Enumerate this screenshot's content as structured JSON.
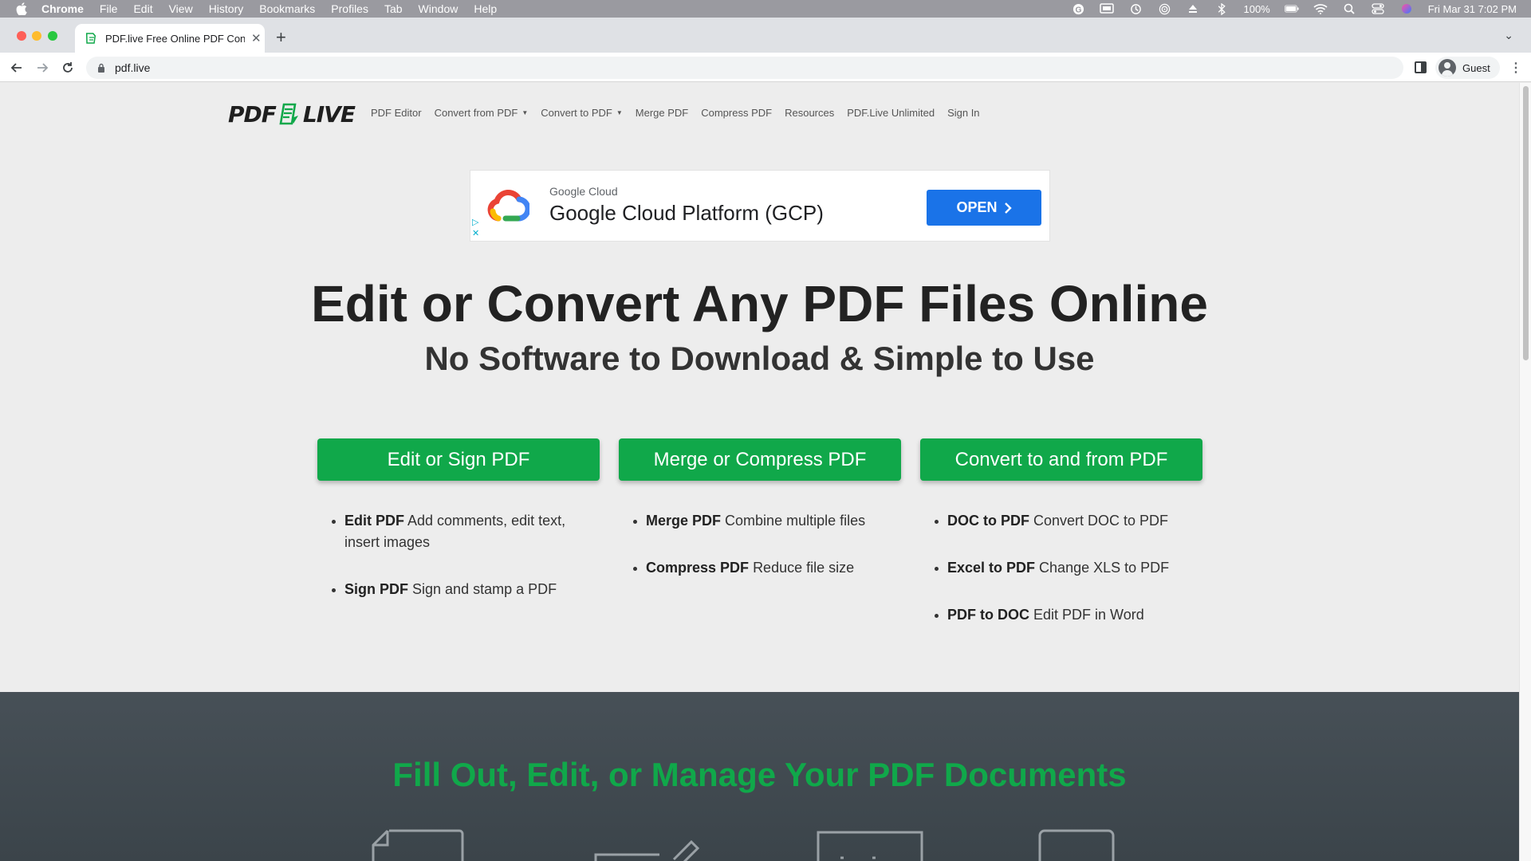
{
  "menubar": {
    "app": "Chrome",
    "items": [
      "File",
      "Edit",
      "View",
      "History",
      "Bookmarks",
      "Profiles",
      "Tab",
      "Window",
      "Help"
    ],
    "battery": "100%",
    "datetime": "Fri Mar 31  7:02 PM"
  },
  "browser": {
    "tab_title": "PDF.live Free Online PDF Conv",
    "url": "pdf.live",
    "profile_label": "Guest"
  },
  "site": {
    "logo_left": "PDF",
    "logo_right": "LIVE",
    "nav": [
      {
        "label": "PDF Editor",
        "dropdown": false
      },
      {
        "label": "Convert from PDF",
        "dropdown": true
      },
      {
        "label": "Convert to PDF",
        "dropdown": true
      },
      {
        "label": "Merge PDF",
        "dropdown": false
      },
      {
        "label": "Compress PDF",
        "dropdown": false
      },
      {
        "label": "Resources",
        "dropdown": false
      },
      {
        "label": "PDF.Live Unlimited",
        "dropdown": false
      },
      {
        "label": "Sign In",
        "dropdown": false
      }
    ]
  },
  "ad": {
    "sponsor": "Google Cloud",
    "headline": "Google Cloud Platform (GCP)",
    "cta": "OPEN"
  },
  "hero": {
    "title": "Edit or Convert Any PDF Files Online",
    "subtitle": "No Software to Download & Simple to Use"
  },
  "actions": [
    {
      "label": "Edit or Sign PDF",
      "features": [
        {
          "name": "Edit PDF",
          "desc": "Add comments, edit text, insert images"
        },
        {
          "name": "Sign PDF",
          "desc": "Sign and stamp a PDF"
        }
      ]
    },
    {
      "label": "Merge or Compress PDF",
      "features": [
        {
          "name": "Merge PDF",
          "desc": "Combine multiple files"
        },
        {
          "name": "Compress PDF",
          "desc": "Reduce file size"
        }
      ]
    },
    {
      "label": "Convert to and from PDF",
      "features": [
        {
          "name": "DOC to PDF",
          "desc": "Convert DOC to PDF"
        },
        {
          "name": "Excel to PDF",
          "desc": "Change XLS to PDF"
        },
        {
          "name": "PDF to DOC",
          "desc": "Edit PDF in Word"
        }
      ]
    }
  ],
  "section": {
    "heading": "Fill Out, Edit, or Manage Your PDF Documents"
  },
  "colors": {
    "brand_green": "#10a84a",
    "ad_blue": "#1a73e8",
    "dark_section": "#414a50"
  }
}
